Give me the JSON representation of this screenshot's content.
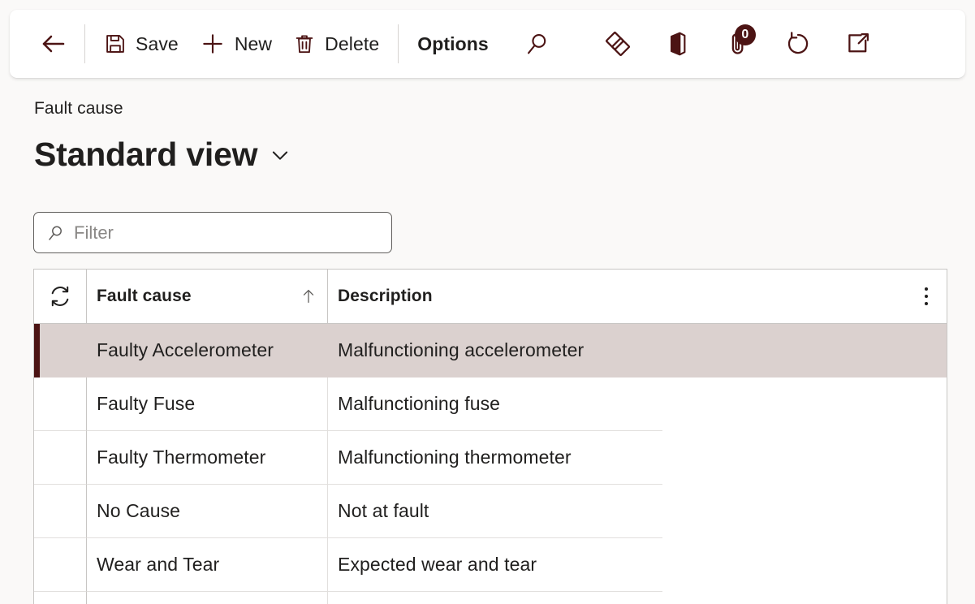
{
  "theme": {
    "accent": "#4c1414",
    "page_bg": "#faf9f8",
    "selected_row_bg": "#dbd1cf",
    "grid_border": "#c8c6c4"
  },
  "toolbar": {
    "back_icon": "arrow-left-icon",
    "save_label": "Save",
    "save_icon": "save-floppy-icon",
    "new_label": "New",
    "new_icon": "plus-icon",
    "delete_label": "Delete",
    "delete_icon": "trash-icon",
    "options_label": "Options",
    "search_icon": "search-icon",
    "powerbi_icon": "diamond-pair-icon",
    "office_icon": "office-app-icon",
    "attachment_icon": "paperclip-icon",
    "attachment_count": "0",
    "refresh_icon": "refresh-circle-icon",
    "open_new_icon": "open-in-new-window-icon"
  },
  "header": {
    "breadcrumb": "Fault cause",
    "title": "Standard view",
    "title_chevron": "chevron-down-icon"
  },
  "filter": {
    "icon": "search-icon",
    "value": "",
    "placeholder": "Filter"
  },
  "grid": {
    "refresh_icon": "sync-refresh-icon",
    "more_icon": "more-vertical-icon",
    "columns": [
      {
        "label": "Fault cause",
        "sort": "ascending",
        "sort_icon": "arrow-up-icon"
      },
      {
        "label": "Description",
        "sort": "none",
        "sort_icon": ""
      }
    ],
    "rows": [
      {
        "name": "Faulty Accelerometer",
        "description": "Malfunctioning accelerometer",
        "selected": true
      },
      {
        "name": "Faulty Fuse",
        "description": "Malfunctioning fuse",
        "selected": false
      },
      {
        "name": "Faulty Thermometer",
        "description": "Malfunctioning thermometer",
        "selected": false
      },
      {
        "name": "No Cause",
        "description": "Not at fault",
        "selected": false
      },
      {
        "name": "Wear and Tear",
        "description": "Expected wear and tear",
        "selected": false
      }
    ]
  }
}
